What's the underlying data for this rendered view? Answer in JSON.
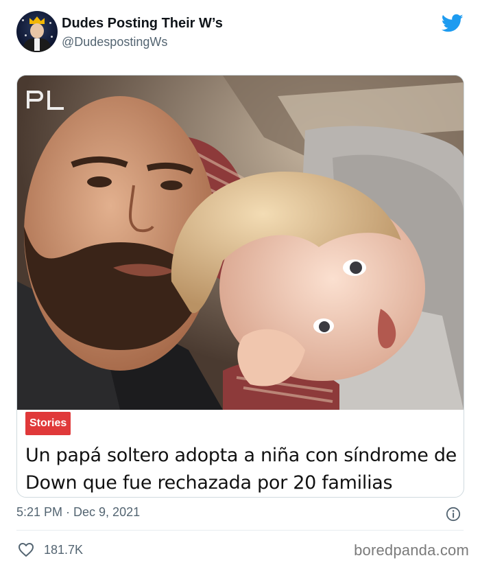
{
  "tweet": {
    "author_name": "Dudes Posting Their W’s",
    "author_handle": "@DudespostingWs",
    "timestamp": "5:21 PM · Dec 9, 2021",
    "like_count": "181.7K"
  },
  "card": {
    "badge_label": "Stories",
    "headline": "Un papá soltero adopta a niña con síndrome de Down que fue rechazada por 20 familias",
    "watermark": "PL"
  },
  "footer": {
    "site_watermark": "boredpanda.com"
  },
  "icons": {
    "brand": "twitter-bird-icon",
    "info": "info-icon",
    "like": "heart-icon"
  },
  "colors": {
    "twitter_blue": "#1d9bf0",
    "badge_red": "#e0393a",
    "secondary_text": "#536471"
  }
}
